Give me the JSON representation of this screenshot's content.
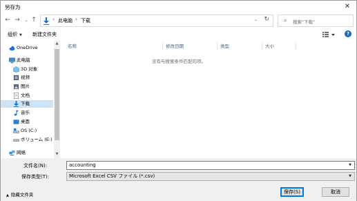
{
  "window": {
    "title": "另存为",
    "close_glyph": "✕"
  },
  "address": {
    "crumbs": [
      "此电脑",
      "下载"
    ],
    "separator": "›",
    "search_placeholder": "搜索\"下载\""
  },
  "toolbar": {
    "organize": "组织",
    "new_folder": "新建文件夹",
    "help": "?"
  },
  "nav": {
    "items": [
      {
        "label": "OneDrive",
        "icon": "cloud-icon",
        "selected": false
      },
      {
        "label": "此电脑",
        "icon": "computer-icon",
        "selected": false
      },
      {
        "label": "3D 对象",
        "icon": "cube-icon",
        "selected": false
      },
      {
        "label": "视频",
        "icon": "video-icon",
        "selected": false
      },
      {
        "label": "图片",
        "icon": "picture-icon",
        "selected": false
      },
      {
        "label": "文档",
        "icon": "document-icon",
        "selected": false
      },
      {
        "label": "下载",
        "icon": "download-icon",
        "selected": true
      },
      {
        "label": "音乐",
        "icon": "music-icon",
        "selected": false
      },
      {
        "label": "桌面",
        "icon": "desktop-icon",
        "selected": false
      },
      {
        "label": "OS (C:)",
        "icon": "drive-icon",
        "selected": false
      },
      {
        "label": "ボリューム (E:)",
        "icon": "drive-icon",
        "selected": false
      },
      {
        "label": "网络",
        "icon": "network-icon",
        "selected": false
      }
    ]
  },
  "filelist": {
    "columns": [
      "名称",
      "修改日期",
      "类型",
      "大小"
    ],
    "empty_message": "没有与搜索条件匹配的项。"
  },
  "form": {
    "filename_label": "文件名(N):",
    "filename_value": "accounting",
    "filetype_label": "保存类型(T):",
    "filetype_value": "Microsoft Excel CSV ファイル (*.csv)"
  },
  "footer": {
    "hide_folders": "隐藏文件夹",
    "save": "保存(S)",
    "cancel": "取消"
  },
  "colors": {
    "accent": "#0078d7",
    "selected_bg": "#cce4f7",
    "download_blue": "#1e6fd0"
  }
}
